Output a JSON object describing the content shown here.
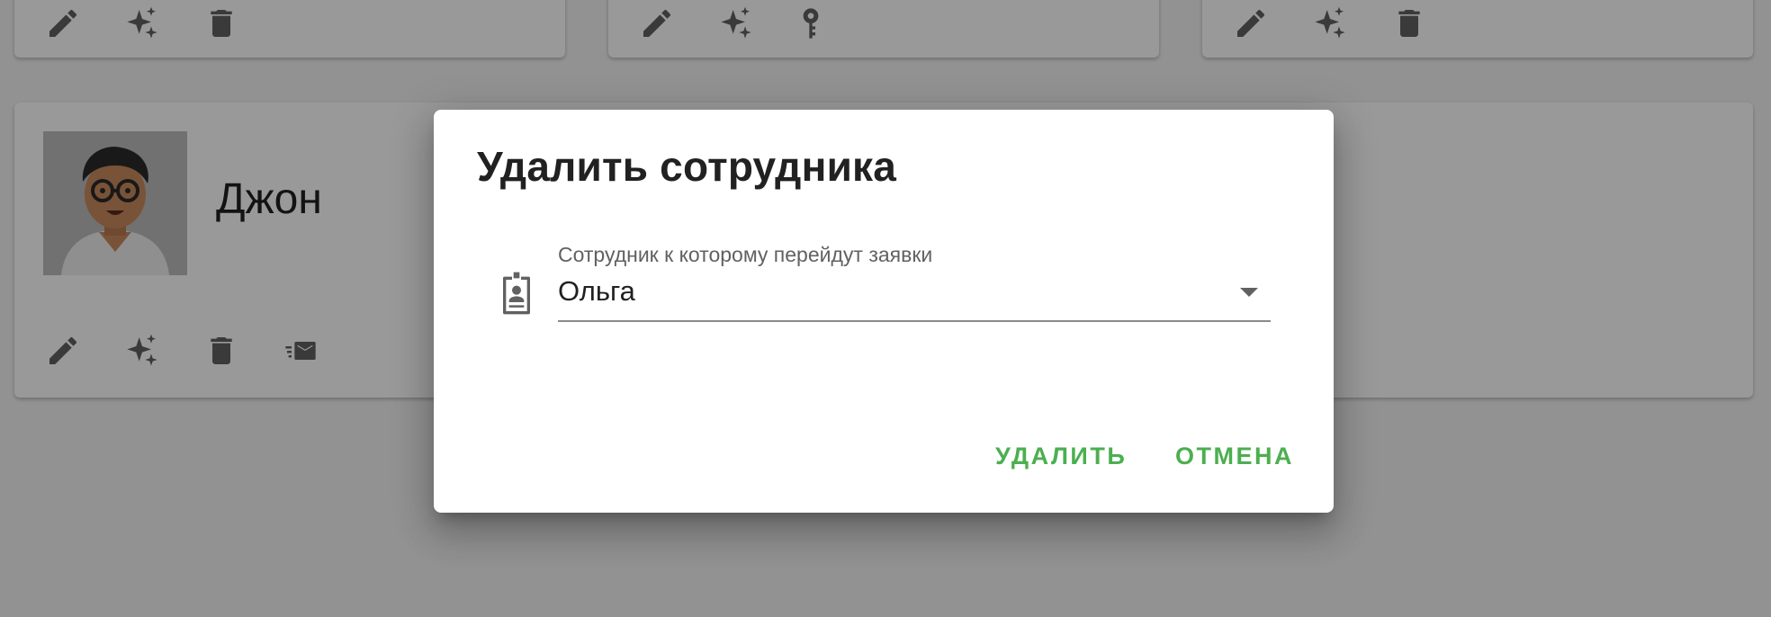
{
  "background": {
    "employee": {
      "name": "Джон"
    },
    "top_cards": [
      {
        "actions": [
          "edit-icon",
          "sparkle-icon",
          "delete-icon"
        ]
      },
      {
        "actions": [
          "edit-icon",
          "sparkle-icon",
          "key-icon"
        ]
      },
      {
        "actions": [
          "edit-icon",
          "sparkle-icon",
          "delete-icon"
        ]
      }
    ],
    "main_card_actions": [
      "edit-icon",
      "sparkle-icon",
      "delete-icon",
      "send-mail-icon"
    ]
  },
  "dialog": {
    "title": "Удалить сотрудника",
    "field": {
      "label": "Сотрудник к которому перейдут заявки",
      "value": "Ольга",
      "icon": "badge-icon"
    },
    "buttons": {
      "delete": "Удалить",
      "cancel": "Отмена"
    }
  },
  "colors": {
    "accent": "#4caf50",
    "overlay": "rgba(0,0,0,0.40)",
    "icon": "#616161"
  }
}
